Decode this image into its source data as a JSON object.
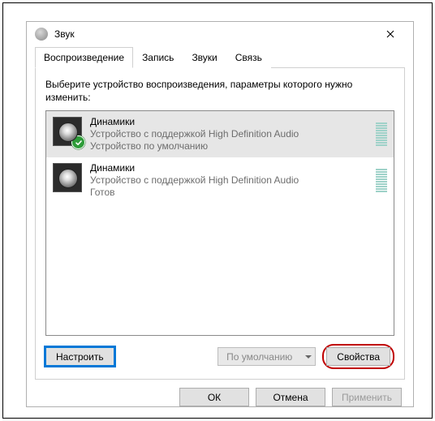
{
  "window": {
    "title": "Звук",
    "close_label": "Close"
  },
  "tabs": [
    {
      "label": "Воспроизведение",
      "active": true
    },
    {
      "label": "Запись",
      "active": false
    },
    {
      "label": "Звуки",
      "active": false
    },
    {
      "label": "Связь",
      "active": false
    }
  ],
  "prompt": "Выберите устройство воспроизведения, параметры которого нужно изменить:",
  "devices": [
    {
      "name": "Динамики",
      "desc": "Устройство с поддержкой High Definition Audio",
      "status": "Устройство по умолчанию",
      "selected": true,
      "is_default": true
    },
    {
      "name": "Динамики",
      "desc": "Устройство с поддержкой High Definition Audio",
      "status": "Готов",
      "selected": false,
      "is_default": false
    }
  ],
  "buttons": {
    "configure": "Настроить",
    "set_default": "По умолчанию",
    "properties": "Свойства"
  },
  "dialog_buttons": {
    "ok": "ОК",
    "cancel": "Отмена",
    "apply": "Применить"
  }
}
